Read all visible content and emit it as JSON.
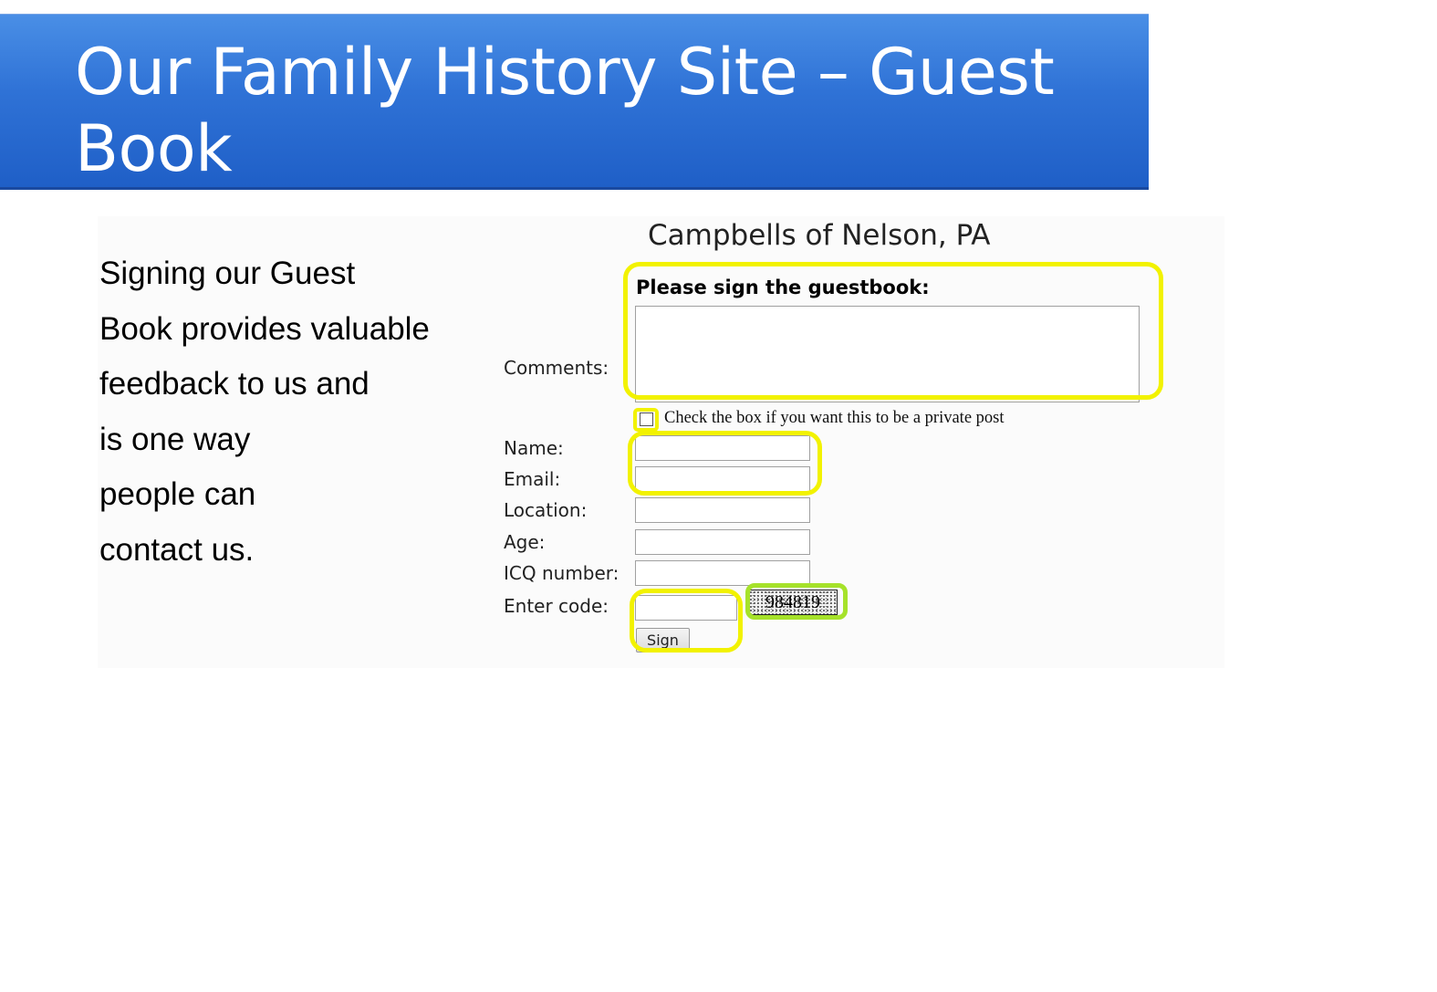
{
  "slide": {
    "title": "Our Family History Site – Guest Book",
    "body_lines": [
      "Signing our Guest",
      "Book provides valuable",
      "feedback to us and",
      "is one way",
      "people can",
      "contact us."
    ]
  },
  "guestbook": {
    "site_title": "Campbells of Nelson, PA",
    "prompt": "Please sign the guestbook:",
    "labels": {
      "comments": "Comments:",
      "name": "Name:",
      "email": "Email:",
      "location": "Location:",
      "age": "Age:",
      "icq": "ICQ number:",
      "code": "Enter code:"
    },
    "private_checkbox_label": "Check the box if you want this to be a private post",
    "private_checked": false,
    "captcha_code": "984819",
    "sign_button": "Sign"
  },
  "colors": {
    "banner": "#2f72d6",
    "highlight_yellow": "#f2f200",
    "highlight_green": "#a6e22a"
  }
}
